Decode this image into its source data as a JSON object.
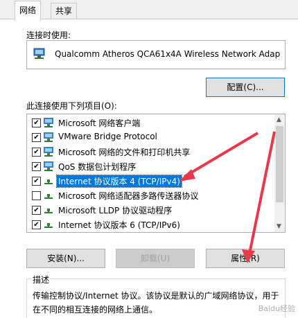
{
  "tabs": [
    {
      "label": "网络"
    },
    {
      "label": "共享"
    }
  ],
  "connect_using_label": "连接时使用:",
  "adapter_name": "Qualcomm Atheros QCA61x4A Wireless Network Adap",
  "configure_button": "配置(C)...",
  "items_label": "此连接使用下列项目(O):",
  "items": [
    {
      "checked": true,
      "label": "Microsoft 网络客户端",
      "icon": "network-client-icon"
    },
    {
      "checked": true,
      "label": "VMware Bridge Protocol",
      "icon": "network-client-icon"
    },
    {
      "checked": true,
      "label": "Microsoft 网络的文件和打印机共享",
      "icon": "network-client-icon"
    },
    {
      "checked": true,
      "label": "QoS 数据包计划程序",
      "icon": "network-client-icon"
    },
    {
      "checked": true,
      "label": "Internet 协议版本 4 (TCP/IPv4)",
      "icon": "protocol-icon",
      "selected": true
    },
    {
      "checked": false,
      "label": "Microsoft 网络适配器多路传送器协议",
      "icon": "protocol-icon"
    },
    {
      "checked": true,
      "label": "Microsoft LLDP 协议驱动程序",
      "icon": "protocol-icon"
    },
    {
      "checked": true,
      "label": "Internet 协议版本 6 (TCP/IPv6)",
      "icon": "protocol-icon"
    }
  ],
  "buttons": {
    "install": "安装(N)...",
    "uninstall": "卸载(U)",
    "properties": "属性(R)"
  },
  "description": {
    "title": "描述",
    "body": "传输控制协议/Internet 协议。该协议是默认的广域网络协议，用于在不同的相互连接的网络上通信。"
  },
  "watermark": "Baidu经验",
  "colors": {
    "annotation_arrow": "#e8394a",
    "selection": "#0078d7"
  }
}
